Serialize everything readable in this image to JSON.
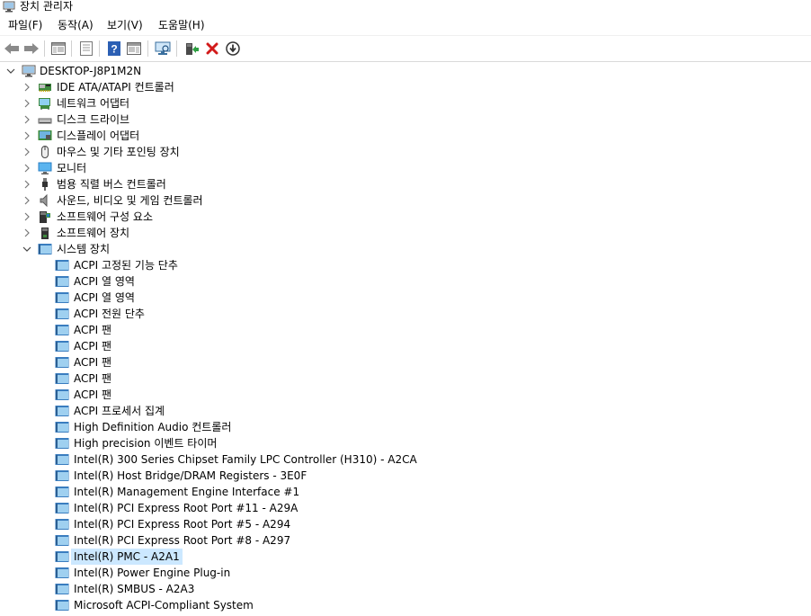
{
  "window": {
    "title": "장치 관리자"
  },
  "menu": [
    {
      "label": "파일(F)"
    },
    {
      "label": "동작(A)"
    },
    {
      "label": "보기(V)"
    },
    {
      "label": "도움말(H)"
    }
  ],
  "toolbar": [
    {
      "name": "back-icon"
    },
    {
      "name": "forward-icon"
    },
    {
      "name": "show-hide-console-tree-icon"
    },
    {
      "name": "properties-icon"
    },
    {
      "name": "help-icon"
    },
    {
      "name": "action-pane-icon"
    },
    {
      "name": "scan-hardware-changes-icon"
    },
    {
      "name": "update-driver-icon"
    },
    {
      "name": "uninstall-device-icon"
    },
    {
      "name": "disable-device-icon"
    }
  ],
  "tree": {
    "root": "DESKTOP-J8P1M2N",
    "categories": [
      {
        "label": "IDE ATA/ATAPI 컨트롤러",
        "icon": "ide-controller-icon"
      },
      {
        "label": "네트워크 어댑터",
        "icon": "network-adapter-icon"
      },
      {
        "label": "디스크 드라이브",
        "icon": "disk-drive-icon"
      },
      {
        "label": "디스플레이 어댑터",
        "icon": "display-adapter-icon"
      },
      {
        "label": "마우스 및 기타 포인팅 장치",
        "icon": "mouse-icon"
      },
      {
        "label": "모니터",
        "icon": "monitor-icon"
      },
      {
        "label": "범용 직렬 버스 컨트롤러",
        "icon": "usb-icon"
      },
      {
        "label": "사운드, 비디오 및 게임 컨트롤러",
        "icon": "sound-icon"
      },
      {
        "label": "소프트웨어 구성 요소",
        "icon": "software-component-icon"
      },
      {
        "label": "소프트웨어 장치",
        "icon": "software-device-icon"
      }
    ],
    "expanded": {
      "label": "시스템 장치",
      "children": [
        "ACPI 고정된 기능 단추",
        "ACPI 열 영역",
        "ACPI 열 영역",
        "ACPI 전원 단추",
        "ACPI 팬",
        "ACPI 팬",
        "ACPI 팬",
        "ACPI 팬",
        "ACPI 팬",
        "ACPI 프로세서 집계",
        "High Definition Audio 컨트롤러",
        "High precision 이벤트 타이머",
        "Intel(R) 300 Series Chipset Family LPC Controller (H310) - A2CA",
        "Intel(R) Host Bridge/DRAM Registers - 3E0F",
        "Intel(R) Management Engine Interface #1",
        "Intel(R) PCI Express Root Port #11 - A29A",
        "Intel(R) PCI Express Root Port #5 - A294",
        "Intel(R) PCI Express Root Port #8 - A297",
        "Intel(R) PMC - A2A1",
        "Intel(R) Power Engine Plug-in",
        "Intel(R) SMBUS - A2A3",
        "Microsoft ACPI-Compliant System"
      ],
      "selected": "Intel(R) PMC - A2A1"
    }
  }
}
